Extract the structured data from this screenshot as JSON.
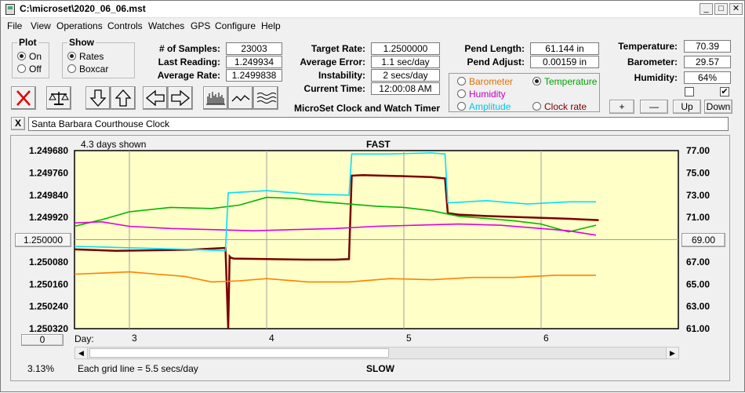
{
  "window": {
    "title": "C:\\microset\\2020_06_06.mst"
  },
  "menu": [
    "File",
    "View",
    "Operations",
    "Controls",
    "Watches",
    "GPS",
    "Configure",
    "Help"
  ],
  "plot_group": {
    "title": "Plot",
    "on": "On",
    "off": "Off",
    "selected": "On"
  },
  "show_group": {
    "title": "Show",
    "rates": "Rates",
    "boxcar": "Boxcar",
    "selected": "Rates"
  },
  "stats": {
    "samples_label": "# of Samples:",
    "samples": "23003",
    "last_label": "Last Reading:",
    "last": "1.249934",
    "avg_rate_label": "Average Rate:",
    "avg_rate": "1.2499838",
    "target_label": "Target Rate:",
    "target": "1.2500000",
    "avg_err_label": "Average Error:",
    "avg_err": "1.1 sec/day",
    "instab_label": "Instability:",
    "instab": "2 secs/day",
    "time_label": "Current Time:",
    "time": "12:00:08 AM",
    "pend_len_label": "Pend Length:",
    "pend_len": "61.144 in",
    "pend_adj_label": "Pend Adjust:",
    "pend_adj": "0.00159 in",
    "temp_label": "Temperature:",
    "temp": "70.39",
    "baro_label": "Barometer:",
    "baro": "29.57",
    "hum_label": "Humidity:",
    "hum": "64%"
  },
  "app_caption": "MicroSet Clock and Watch Timer",
  "sensor_select": {
    "barometer": "Barometer",
    "temperature": "Temperature",
    "humidity": "Humidity",
    "amplitude": "Amplitude",
    "clock_rate": "Clock rate",
    "selected": "Temperature"
  },
  "adjust_buttons": {
    "plus": "+",
    "minus": "—",
    "up": "Up",
    "down": "Down"
  },
  "clock_name": "Santa Barbara Courthouse Clock",
  "clear_name": "X",
  "plot": {
    "days_shown": "4.3 days shown",
    "fast_label": "FAST",
    "slow_label": "SLOW",
    "grid_note": "Each grid line = 5.5 secs/day",
    "left_button": "1.250000",
    "right_button": "69.00",
    "zero_button": "0",
    "percent": "3.13%",
    "day_label": "Day:",
    "day_ticks": [
      "3",
      "4",
      "5",
      "6"
    ]
  },
  "chart_data": {
    "type": "line",
    "x_label": "Day",
    "y_left": {
      "ticks": [
        "1.249680",
        "1.249760",
        "1.249840",
        "1.249920",
        "1.250000",
        "1.250080",
        "1.250160",
        "1.250240",
        "1.250320"
      ],
      "ylim": [
        1.25032,
        1.24968
      ],
      "inverted": true
    },
    "y_right": {
      "ticks": [
        "77.00",
        "75.00",
        "73.00",
        "71.00",
        "69.00",
        "67.00",
        "65.00",
        "63.00",
        "61.00"
      ],
      "ylim": [
        61,
        77
      ]
    },
    "xlim": [
      2.6,
      7.0
    ],
    "colors": {
      "rate": "#7a0000",
      "temperature": "#00b400",
      "humidity": "#e000e0",
      "amplitude": "#00e0ff",
      "barometer": "#ff8000"
    },
    "series": [
      {
        "name": "Clock rate",
        "axis": "left",
        "color": "#7a0000",
        "x": [
          2.6,
          2.9,
          3.2,
          3.45,
          3.7,
          3.72,
          3.73,
          3.74,
          3.76,
          4.0,
          4.3,
          4.5,
          4.6,
          4.62,
          4.7,
          5.0,
          5.2,
          5.3,
          5.32,
          5.4,
          5.6,
          5.9,
          6.2,
          6.42
        ],
        "y": [
          1.250035,
          1.25004,
          1.250038,
          1.250036,
          1.25003,
          1.25032,
          1.25006,
          1.250065,
          1.250068,
          1.25007,
          1.250072,
          1.250072,
          1.25007,
          1.24977,
          1.249768,
          1.249772,
          1.249775,
          1.24978,
          1.249905,
          1.24991,
          1.249915,
          1.24992,
          1.249925,
          1.24993
        ]
      },
      {
        "name": "Temperature",
        "axis": "right",
        "color": "#00b400",
        "x": [
          2.6,
          2.8,
          3.0,
          3.3,
          3.6,
          3.8,
          4.0,
          4.2,
          4.4,
          4.6,
          4.8,
          5.0,
          5.2,
          5.4,
          5.6,
          5.8,
          6.0,
          6.2,
          6.4
        ],
        "y": [
          70.2,
          70.8,
          71.5,
          71.9,
          71.8,
          72.1,
          72.8,
          72.7,
          72.4,
          72.2,
          72.0,
          71.9,
          71.6,
          71.1,
          70.9,
          70.7,
          70.4,
          69.7,
          70.3
        ]
      },
      {
        "name": "Humidity",
        "axis": "right",
        "color": "#e000e0",
        "x": [
          2.6,
          2.8,
          3.0,
          3.3,
          3.6,
          3.9,
          4.2,
          4.5,
          4.8,
          5.1,
          5.4,
          5.7,
          6.0,
          6.2,
          6.4
        ],
        "y": [
          70.5,
          70.6,
          70.2,
          70.0,
          69.9,
          69.8,
          69.9,
          70.0,
          70.2,
          70.3,
          70.4,
          70.3,
          70.0,
          69.8,
          69.4
        ]
      },
      {
        "name": "Amplitude",
        "axis": "right",
        "color": "#00e0ff",
        "x": [
          2.6,
          2.9,
          3.2,
          3.5,
          3.7,
          3.72,
          4.0,
          4.3,
          4.6,
          4.62,
          4.9,
          5.2,
          5.3,
          5.32,
          5.6,
          5.9,
          6.2,
          6.4
        ],
        "y": [
          68.4,
          68.3,
          68.2,
          68.1,
          68.0,
          73.2,
          73.4,
          73.1,
          73.0,
          76.7,
          76.7,
          76.8,
          76.7,
          72.3,
          72.5,
          72.2,
          72.4,
          72.4
        ]
      },
      {
        "name": "Barometer",
        "axis": "right",
        "color": "#ff8000",
        "x": [
          2.6,
          2.8,
          3.0,
          3.2,
          3.4,
          3.6,
          3.8,
          4.0,
          4.3,
          4.6,
          4.9,
          5.2,
          5.5,
          5.8,
          6.1,
          6.4
        ],
        "y": [
          65.9,
          66.0,
          66.1,
          65.9,
          65.7,
          65.2,
          65.3,
          65.5,
          65.2,
          65.2,
          65.5,
          65.4,
          65.6,
          65.6,
          65.8,
          65.8
        ]
      }
    ],
    "grid_x": [
      3,
      4,
      5,
      6
    ],
    "reference_line": {
      "axis": "left",
      "value": 1.25
    }
  }
}
